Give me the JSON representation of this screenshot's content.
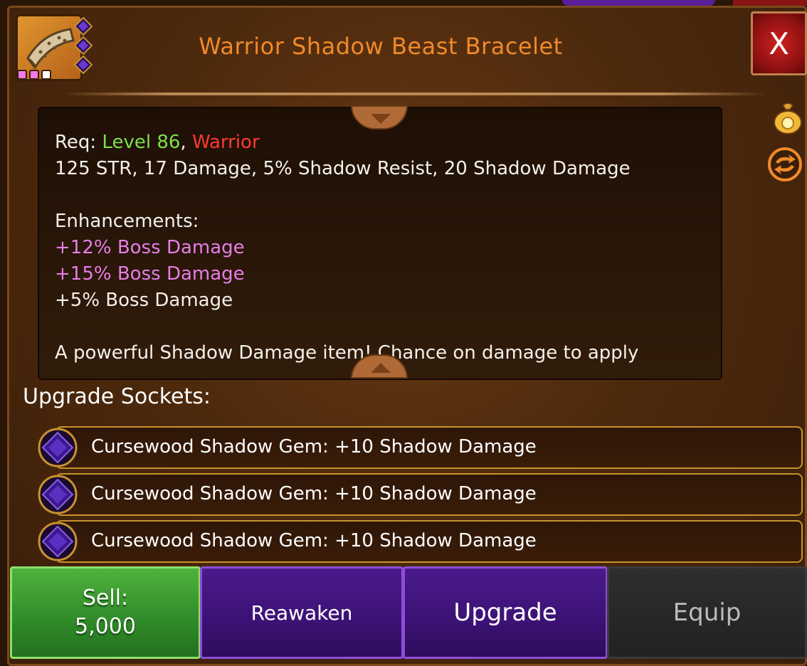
{
  "item": {
    "title": "Warrior Shadow Beast Bracelet",
    "rarity_dot_colors": [
      "#f07ae6",
      "#f07ae6",
      "#ffffff"
    ],
    "icon": "bracelet-icon"
  },
  "close_label": "X",
  "description": {
    "req_prefix": "Req: ",
    "req_level": "Level 86",
    "req_sep": ", ",
    "req_class": "Warrior",
    "stats": "125 STR, 17 Damage, 5% Shadow Resist, 20 Shadow Damage",
    "enhancements_heading": "Enhancements:",
    "enhancements": [
      "+12% Boss Damage",
      "+15% Boss Damage",
      "+5% Boss Damage"
    ],
    "flavor": "A powerful Shadow Damage item! Chance on damage to apply"
  },
  "sockets_label": "Upgrade Sockets:",
  "sockets": [
    {
      "text": "Cursewood Shadow Gem: +10 Shadow Damage"
    },
    {
      "text": "Cursewood Shadow Gem: +10 Shadow Damage"
    },
    {
      "text": "Cursewood Shadow Gem: +10 Shadow Damage"
    }
  ],
  "buttons": {
    "sell_line1": "Sell:",
    "sell_line2": "5,000",
    "reawaken": "Reawaken",
    "upgrade": "Upgrade",
    "equip": "Equip"
  },
  "colors": {
    "title": "#f08a2a",
    "level": "#7be04a",
    "class": "#ff3b2e",
    "enhancement_pink": "#e67ee6",
    "sell_green": "#2f8a28",
    "purple": "#3c1275",
    "close_red": "#b01818"
  }
}
